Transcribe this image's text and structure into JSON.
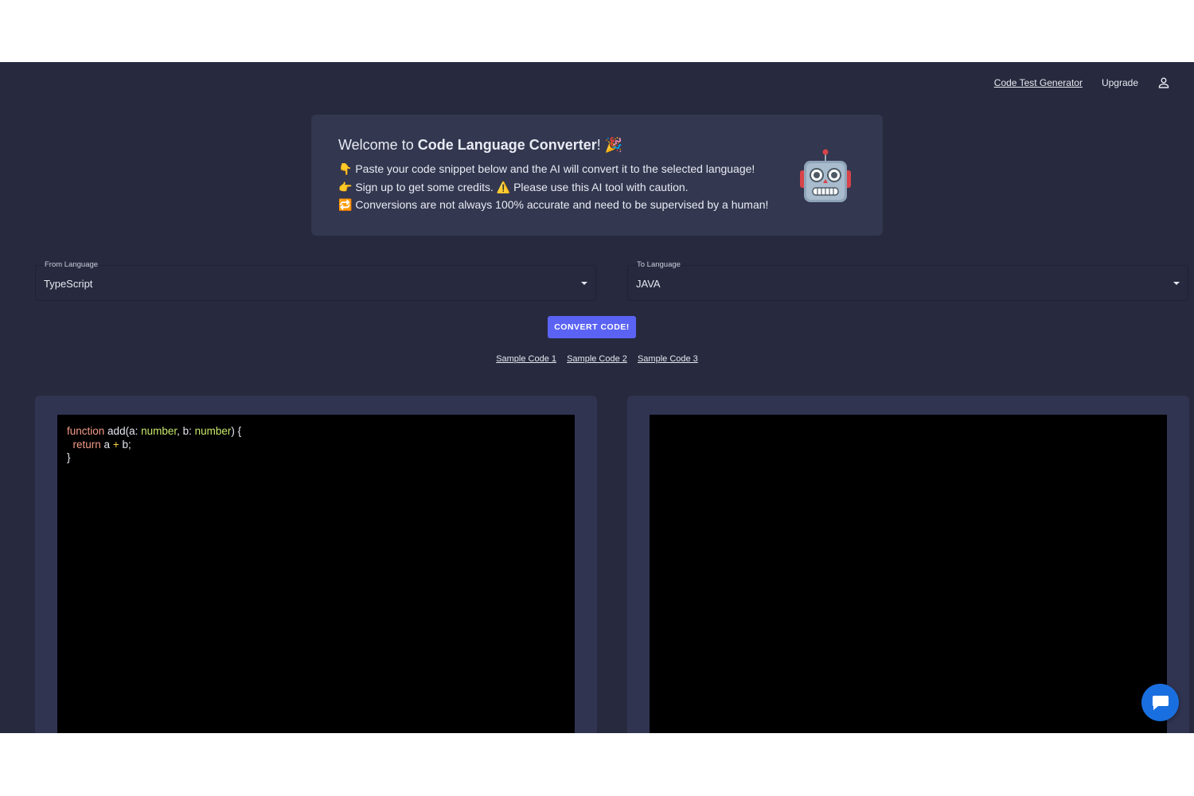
{
  "nav": {
    "code_test_generator": "Code Test Generator",
    "upgrade": "Upgrade",
    "account_icon": "user-icon"
  },
  "banner": {
    "title_prefix": "Welcome to ",
    "title_bold": "Code Language Converter",
    "title_suffix": "! 🎉",
    "line1": "👇 Paste your code snippet below and the AI will convert it to the selected language!",
    "line2": "👉 Sign up to get some credits. ⚠️ Please use this AI tool with caution.",
    "line3": "🔁 Conversions are not always 100% accurate and need to be supervised by a human!",
    "robot_icon": "robot-icon"
  },
  "from_language": {
    "label": "From Language",
    "value": "TypeScript"
  },
  "to_language": {
    "label": "To Language",
    "value": "JAVA"
  },
  "convert_button": "CONVERT CODE!",
  "samples": [
    "Sample Code 1",
    "Sample Code 2",
    "Sample Code 3"
  ],
  "input_code": {
    "line1": {
      "kw": "function",
      "fn": " add(a: ",
      "t1": "number",
      "mid": ", b: ",
      "t2": "number",
      "end": ") {"
    },
    "line2": {
      "indent": "  ",
      "kw": "return",
      "a": " a ",
      "op": "+",
      "b": " b;"
    },
    "line3": "}"
  },
  "output_code": "",
  "chat_icon": "chat-bubble-icon",
  "colors": {
    "background": "#272a3e",
    "panel": "#303451",
    "accent": "#5b63f4",
    "chat": "#1a6fe0"
  }
}
